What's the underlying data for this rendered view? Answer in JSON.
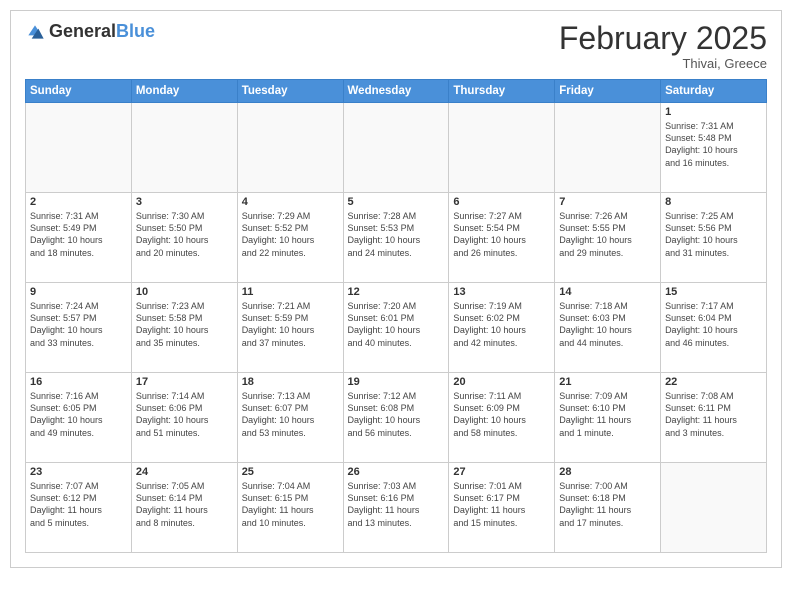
{
  "logo": {
    "general": "General",
    "blue": "Blue"
  },
  "title": "February 2025",
  "location": "Thivai, Greece",
  "weekdays": [
    "Sunday",
    "Monday",
    "Tuesday",
    "Wednesday",
    "Thursday",
    "Friday",
    "Saturday"
  ],
  "weeks": [
    [
      {
        "day": "",
        "info": ""
      },
      {
        "day": "",
        "info": ""
      },
      {
        "day": "",
        "info": ""
      },
      {
        "day": "",
        "info": ""
      },
      {
        "day": "",
        "info": ""
      },
      {
        "day": "",
        "info": ""
      },
      {
        "day": "1",
        "info": "Sunrise: 7:31 AM\nSunset: 5:48 PM\nDaylight: 10 hours\nand 16 minutes."
      }
    ],
    [
      {
        "day": "2",
        "info": "Sunrise: 7:31 AM\nSunset: 5:49 PM\nDaylight: 10 hours\nand 18 minutes."
      },
      {
        "day": "3",
        "info": "Sunrise: 7:30 AM\nSunset: 5:50 PM\nDaylight: 10 hours\nand 20 minutes."
      },
      {
        "day": "4",
        "info": "Sunrise: 7:29 AM\nSunset: 5:52 PM\nDaylight: 10 hours\nand 22 minutes."
      },
      {
        "day": "5",
        "info": "Sunrise: 7:28 AM\nSunset: 5:53 PM\nDaylight: 10 hours\nand 24 minutes."
      },
      {
        "day": "6",
        "info": "Sunrise: 7:27 AM\nSunset: 5:54 PM\nDaylight: 10 hours\nand 26 minutes."
      },
      {
        "day": "7",
        "info": "Sunrise: 7:26 AM\nSunset: 5:55 PM\nDaylight: 10 hours\nand 29 minutes."
      },
      {
        "day": "8",
        "info": "Sunrise: 7:25 AM\nSunset: 5:56 PM\nDaylight: 10 hours\nand 31 minutes."
      }
    ],
    [
      {
        "day": "9",
        "info": "Sunrise: 7:24 AM\nSunset: 5:57 PM\nDaylight: 10 hours\nand 33 minutes."
      },
      {
        "day": "10",
        "info": "Sunrise: 7:23 AM\nSunset: 5:58 PM\nDaylight: 10 hours\nand 35 minutes."
      },
      {
        "day": "11",
        "info": "Sunrise: 7:21 AM\nSunset: 5:59 PM\nDaylight: 10 hours\nand 37 minutes."
      },
      {
        "day": "12",
        "info": "Sunrise: 7:20 AM\nSunset: 6:01 PM\nDaylight: 10 hours\nand 40 minutes."
      },
      {
        "day": "13",
        "info": "Sunrise: 7:19 AM\nSunset: 6:02 PM\nDaylight: 10 hours\nand 42 minutes."
      },
      {
        "day": "14",
        "info": "Sunrise: 7:18 AM\nSunset: 6:03 PM\nDaylight: 10 hours\nand 44 minutes."
      },
      {
        "day": "15",
        "info": "Sunrise: 7:17 AM\nSunset: 6:04 PM\nDaylight: 10 hours\nand 46 minutes."
      }
    ],
    [
      {
        "day": "16",
        "info": "Sunrise: 7:16 AM\nSunset: 6:05 PM\nDaylight: 10 hours\nand 49 minutes."
      },
      {
        "day": "17",
        "info": "Sunrise: 7:14 AM\nSunset: 6:06 PM\nDaylight: 10 hours\nand 51 minutes."
      },
      {
        "day": "18",
        "info": "Sunrise: 7:13 AM\nSunset: 6:07 PM\nDaylight: 10 hours\nand 53 minutes."
      },
      {
        "day": "19",
        "info": "Sunrise: 7:12 AM\nSunset: 6:08 PM\nDaylight: 10 hours\nand 56 minutes."
      },
      {
        "day": "20",
        "info": "Sunrise: 7:11 AM\nSunset: 6:09 PM\nDaylight: 10 hours\nand 58 minutes."
      },
      {
        "day": "21",
        "info": "Sunrise: 7:09 AM\nSunset: 6:10 PM\nDaylight: 11 hours\nand 1 minute."
      },
      {
        "day": "22",
        "info": "Sunrise: 7:08 AM\nSunset: 6:11 PM\nDaylight: 11 hours\nand 3 minutes."
      }
    ],
    [
      {
        "day": "23",
        "info": "Sunrise: 7:07 AM\nSunset: 6:12 PM\nDaylight: 11 hours\nand 5 minutes."
      },
      {
        "day": "24",
        "info": "Sunrise: 7:05 AM\nSunset: 6:14 PM\nDaylight: 11 hours\nand 8 minutes."
      },
      {
        "day": "25",
        "info": "Sunrise: 7:04 AM\nSunset: 6:15 PM\nDaylight: 11 hours\nand 10 minutes."
      },
      {
        "day": "26",
        "info": "Sunrise: 7:03 AM\nSunset: 6:16 PM\nDaylight: 11 hours\nand 13 minutes."
      },
      {
        "day": "27",
        "info": "Sunrise: 7:01 AM\nSunset: 6:17 PM\nDaylight: 11 hours\nand 15 minutes."
      },
      {
        "day": "28",
        "info": "Sunrise: 7:00 AM\nSunset: 6:18 PM\nDaylight: 11 hours\nand 17 minutes."
      },
      {
        "day": "",
        "info": ""
      }
    ]
  ]
}
